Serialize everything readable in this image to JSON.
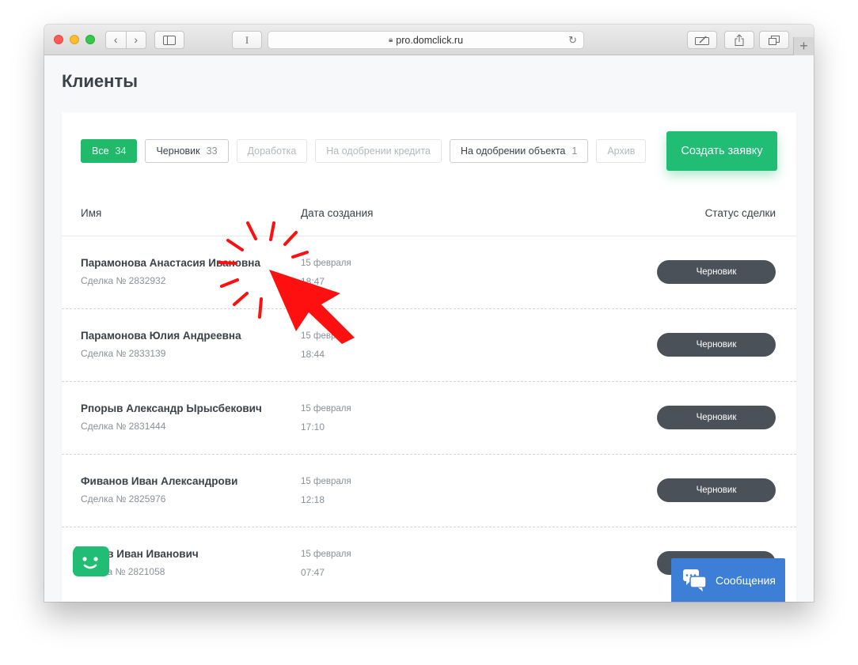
{
  "browser": {
    "url": "pro.domclick.ru",
    "nav_back": "‹",
    "nav_forward": "›",
    "reader_label": "I",
    "new_tab": "+"
  },
  "page": {
    "title": "Клиенты"
  },
  "filters": [
    {
      "label": "Все",
      "count": "34",
      "state": "active"
    },
    {
      "label": "Черновик",
      "count": "33",
      "state": "normal"
    },
    {
      "label": "Доработка",
      "count": "",
      "state": "disabled"
    },
    {
      "label": "На одобрении кредита",
      "count": "",
      "state": "disabled"
    },
    {
      "label": "На одобрении объекта",
      "count": "1",
      "state": "normal"
    },
    {
      "label": "Архив",
      "count": "",
      "state": "disabled"
    }
  ],
  "create_button": "Создать заявку",
  "table": {
    "col_name": "Имя",
    "col_date": "Дата создания",
    "col_status": "Статус сделки",
    "rows": [
      {
        "name": "Парамонова Анастасия Ивановна",
        "deal": "Сделка № 2832932",
        "date": "15 февраля",
        "time": "18:47",
        "status": "Черновик"
      },
      {
        "name": "Парамонова Юлия Андреевна",
        "deal": "Сделка № 2833139",
        "date": "15 февраля",
        "time": "18:44",
        "status": "Черновик"
      },
      {
        "name": "Рпорыв Александр Ырысбекович",
        "deal": "Сделка № 2831444",
        "date": "15 февраля",
        "time": "17:10",
        "status": "Черновик"
      },
      {
        "name": "Фиванов Иван Александрови",
        "deal": "Сделка № 2825976",
        "date": "15 февраля",
        "time": "12:18",
        "status": "Черновик"
      },
      {
        "name": "ов Иван Иванович",
        "deal": "ка № 2821058",
        "date": "15 февраля",
        "time": "07:47",
        "status": ""
      }
    ]
  },
  "messages_widget": "Сообщения",
  "colors": {
    "accent_green": "#21bd75",
    "status_dark": "#4a5159",
    "messages_blue": "#3d7fd6",
    "cursor_red": "#ff0000"
  },
  "icons": [
    "lock-icon",
    "reload-icon",
    "sidebar-icon",
    "share-icon",
    "tabs-icon",
    "chat-bot-icon",
    "chat-bubbles-icon",
    "click-cursor-icon"
  ]
}
